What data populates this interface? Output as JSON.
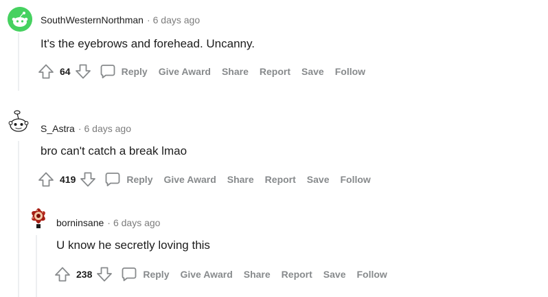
{
  "comments": [
    {
      "author": "SouthWesternNorthman",
      "time": "6 days ago",
      "text": "It's the eyebrows and forehead. Uncanny.",
      "votes": "64",
      "avatar_color": "#46d160"
    },
    {
      "author": "S_Astra",
      "time": "6 days ago",
      "text": "bro can't catch a break lmao",
      "votes": "419",
      "avatar_color": "#ffffff"
    },
    {
      "author": "borninsane",
      "time": "6 days ago",
      "text": "U know he secretly loving this",
      "votes": "238",
      "avatar_color": "#8b1a12"
    }
  ],
  "actions": {
    "reply": "Reply",
    "give_award": "Give Award",
    "share": "Share",
    "report": "Report",
    "save": "Save",
    "follow": "Follow"
  },
  "separator": "·",
  "icons": {
    "upvote": "arrow-up-icon",
    "downvote": "arrow-down-icon",
    "reply": "chat-bubble-icon"
  },
  "colors": {
    "meta_gray": "#7c7c7c",
    "action_gray": "#878a8c",
    "thread_line": "#edeff1"
  }
}
